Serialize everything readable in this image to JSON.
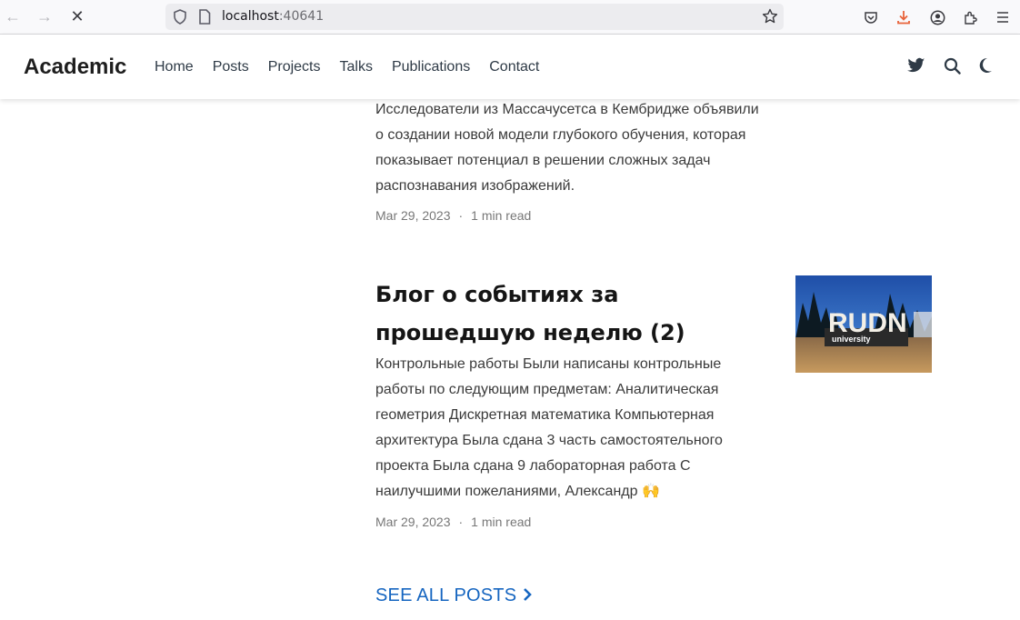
{
  "browser": {
    "url_host": "localhost",
    "url_port": ":40641",
    "icons": [
      "back-icon",
      "forward-icon",
      "stop-icon",
      "shield-icon",
      "page-icon",
      "star-icon",
      "pocket-icon",
      "download-icon",
      "account-icon",
      "extensions-icon",
      "menu-icon"
    ]
  },
  "nav": {
    "brand": "Academic",
    "links": [
      "Home",
      "Posts",
      "Projects",
      "Talks",
      "Publications",
      "Contact"
    ],
    "icons": [
      "twitter-icon",
      "search-icon",
      "moon-icon"
    ]
  },
  "post1": {
    "summary": "Исследователи из Массачусетса в Кембридже объявили о создании новой модели глубокого обучения, которая показывает потенциал в решении сложных задач распознавания изображений.",
    "date": "Mar 29, 2023",
    "separator": "·",
    "read": "1 min read"
  },
  "post2": {
    "title": "Блог о событиях за прошедшую неделю (2)",
    "summary": "Контрольные работы Были написаны контрольные работы по следующим предметам: Аналитическая геометрия Дискретная математика Компьютерная архитектура Была сдана 3 часть самостоятельного проекта Была сдана 9 лабораторная работа С наилучшими пожеланиями, Александр 🙌",
    "date": "Mar 29, 2023",
    "separator": "·",
    "read": "1 min read",
    "thumbnail_text": "RUDN",
    "thumbnail_subtext": "university"
  },
  "see_all": {
    "label": "SEE ALL POSTS",
    "arrow": "›"
  },
  "colors": {
    "accent": "#1565c0",
    "download": "#e8633a"
  }
}
